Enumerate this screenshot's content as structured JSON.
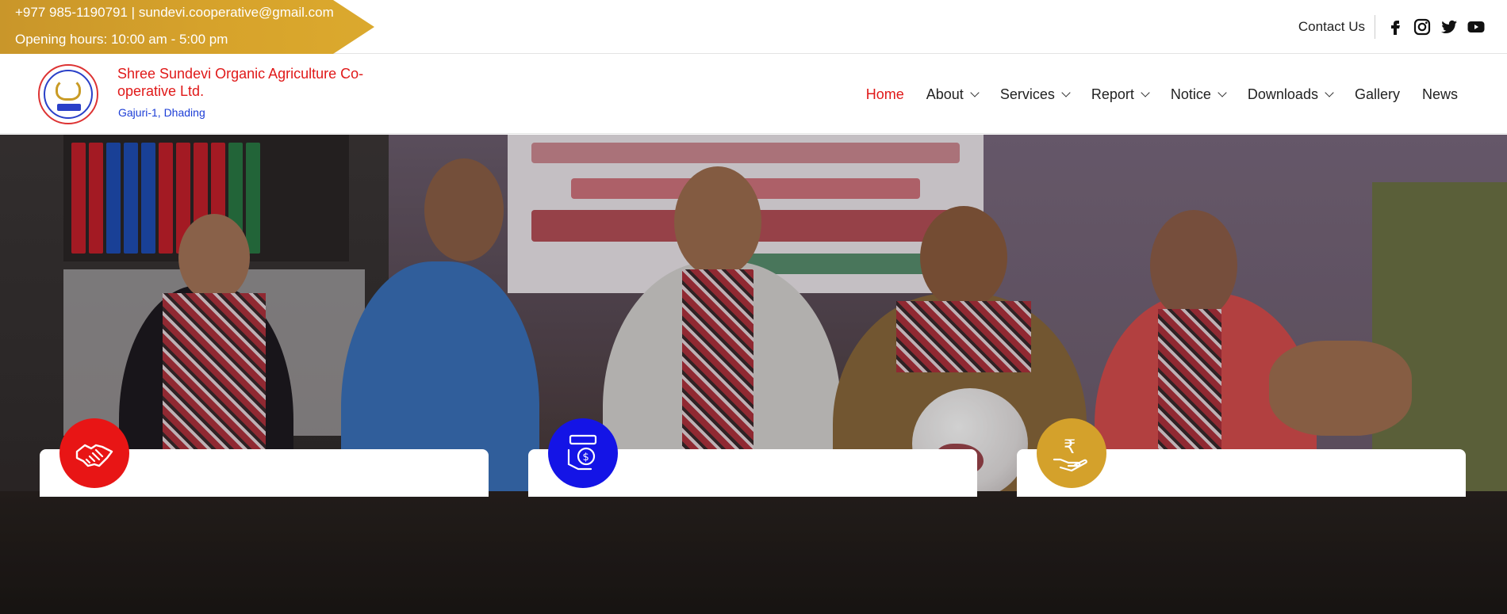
{
  "topbar": {
    "contact_line": "+977 985-1190791 | sundevi.cooperative@gmail.com",
    "hours_line": "Opening hours: 10:00 am - 5:00 pm",
    "contact_us": "Contact Us",
    "social": [
      "facebook-icon",
      "instagram-icon",
      "twitter-icon",
      "youtube-icon"
    ]
  },
  "header": {
    "org_name": "Shree Sundevi Organic Agriculture Co-operative Ltd.",
    "org_address": "Gajuri-1, Dhading"
  },
  "nav": {
    "items": [
      {
        "label": "Home",
        "active": true,
        "dropdown": false
      },
      {
        "label": "About",
        "dropdown": true
      },
      {
        "label": "Services",
        "dropdown": true
      },
      {
        "label": "Report",
        "dropdown": true
      },
      {
        "label": "Notice",
        "dropdown": true
      },
      {
        "label": "Downloads",
        "dropdown": true
      },
      {
        "label": "Gallery",
        "dropdown": false
      },
      {
        "label": "News",
        "dropdown": false
      }
    ]
  },
  "colors": {
    "accent_red": "#e01919",
    "gold": "#d4a12b",
    "blue": "#1414e6",
    "link_blue": "#1c3dd6"
  },
  "cards": [
    {
      "icon": "handshake-icon",
      "color": "#e81515"
    },
    {
      "icon": "deposit-icon",
      "color": "#1414e6"
    },
    {
      "icon": "rupee-hand-icon",
      "color": "#d4a12b"
    }
  ]
}
